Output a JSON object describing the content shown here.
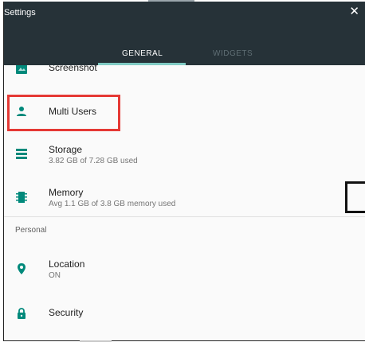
{
  "header": {
    "title": "Settings",
    "close_glyph": "✕"
  },
  "tabs": [
    {
      "label": "GENERAL",
      "active": true
    },
    {
      "label": "WIDGETS",
      "active": false
    }
  ],
  "items": [
    {
      "label": "Screenshot",
      "icon": "screenshot-icon"
    },
    {
      "label": "Multi Users",
      "icon": "person-icon"
    },
    {
      "label": "Storage",
      "sub": "3.82 GB of 7.28 GB used",
      "icon": "storage-icon"
    },
    {
      "label": "Memory",
      "sub": "Avg 1.1 GB of 3.8 GB memory used",
      "icon": "memory-icon"
    }
  ],
  "sections": {
    "personal": "Personal"
  },
  "personal_items": [
    {
      "label": "Location",
      "sub": "ON",
      "icon": "location-pin-icon"
    },
    {
      "label": "Security",
      "icon": "lock-icon"
    }
  ],
  "colors": {
    "header_bg": "#263238",
    "accent": "#00897b",
    "tab_indicator": "#80cbc4",
    "highlight": "#e53935"
  }
}
